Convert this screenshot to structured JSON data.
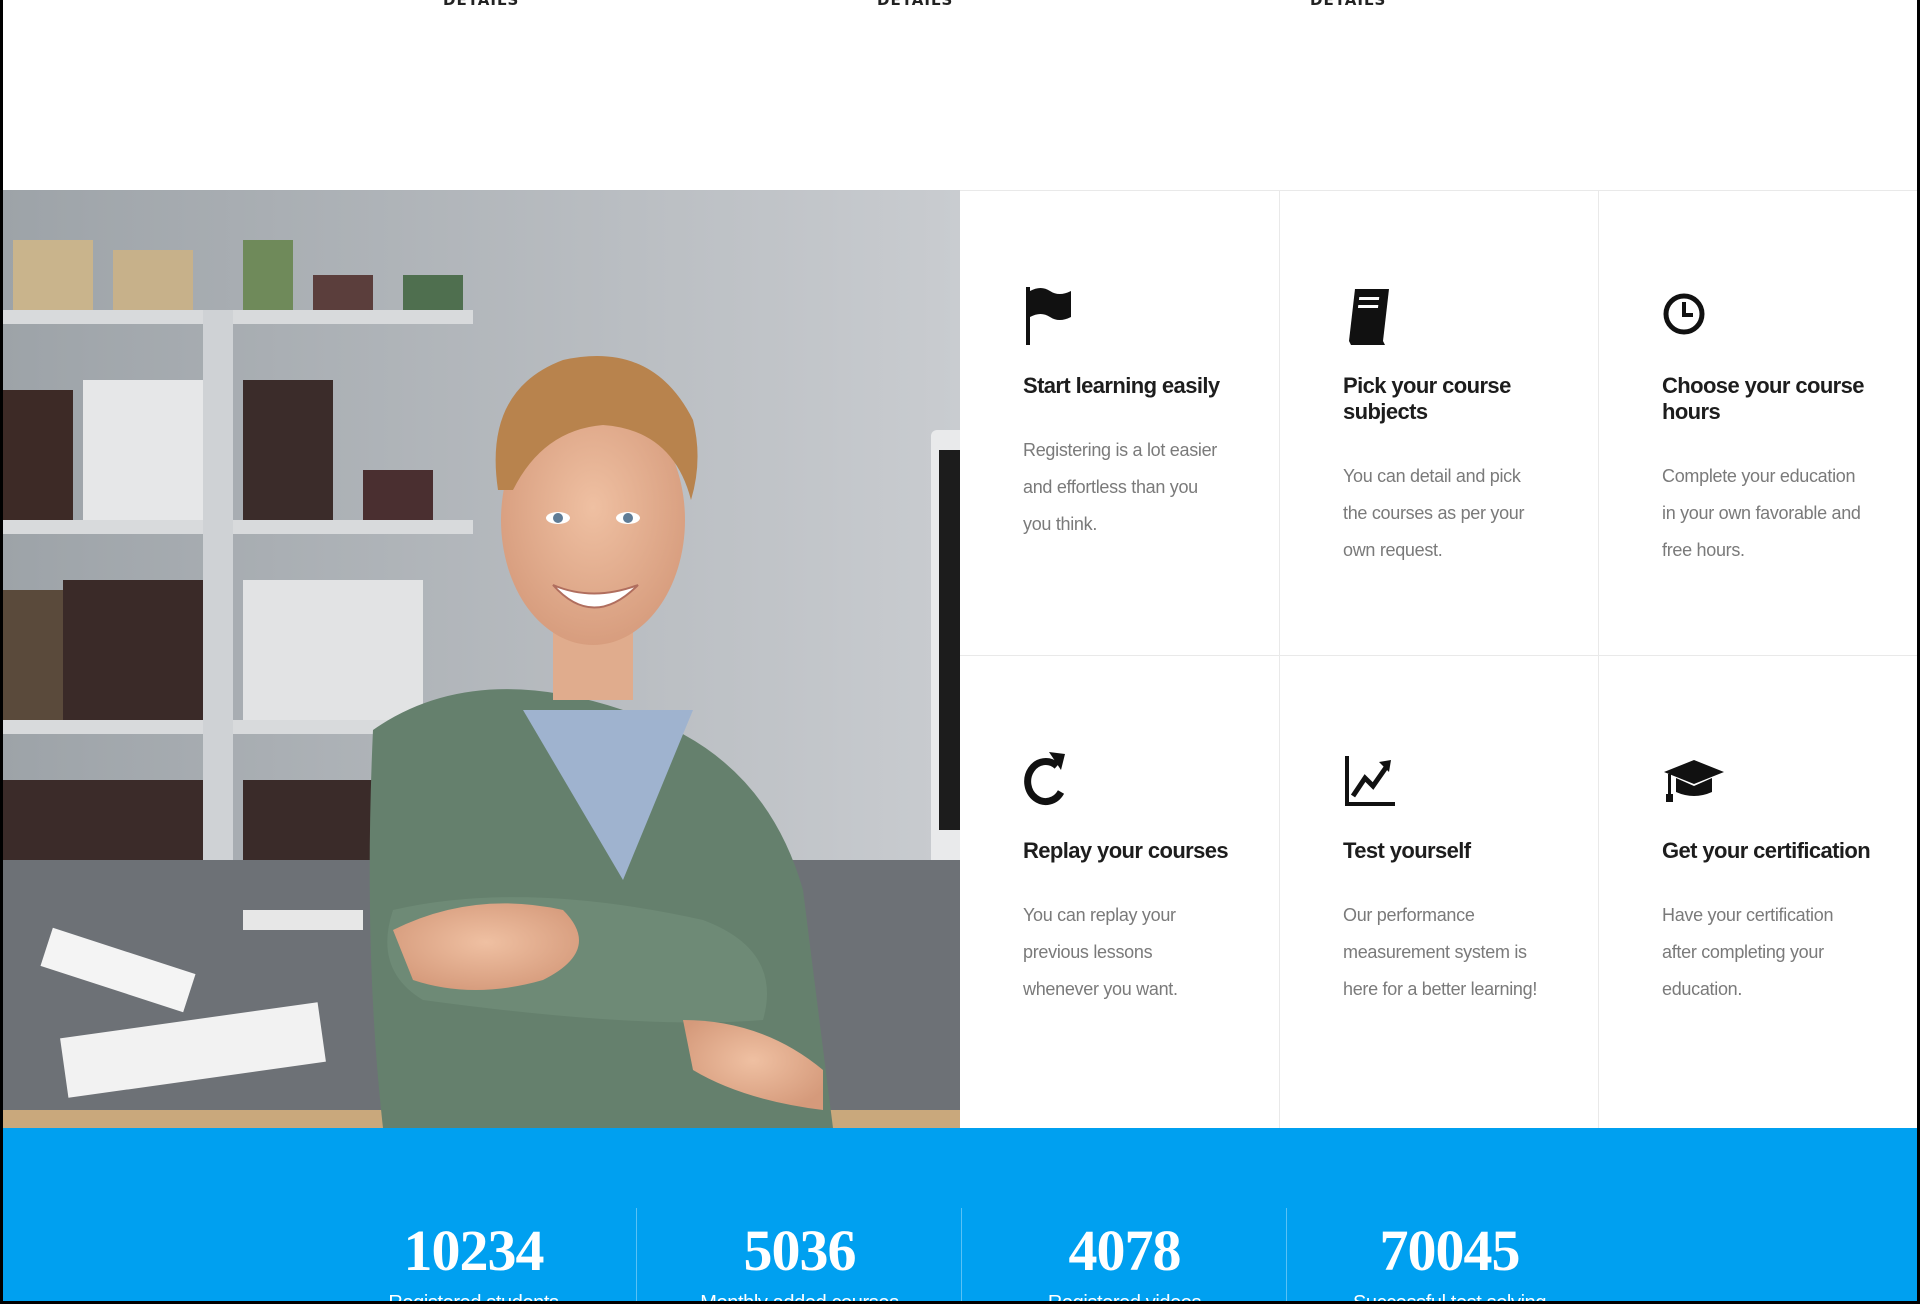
{
  "top_links": [
    "DETAILS",
    "DETAILS",
    "DETAILS"
  ],
  "features": [
    {
      "icon": "flag-icon",
      "title": "Start learning easily",
      "text": "Registering is a lot easier and effortless than you you think."
    },
    {
      "icon": "book-icon",
      "title": "Pick your course subjects",
      "text": "You can detail and pick the courses as per your own request."
    },
    {
      "icon": "clock-icon",
      "title": "Choose your course hours",
      "text": "Complete your education in your own favorable and free hours."
    },
    {
      "icon": "replay-icon",
      "title": "Replay your courses",
      "text": "You can replay your previous lessons whenever you want."
    },
    {
      "icon": "line-chart-icon",
      "title": "Test yourself",
      "text": "Our performance measurement system is here for a better learning!"
    },
    {
      "icon": "graduation-cap-icon",
      "title": "Get your certification",
      "text": "Have your certification after completing your education."
    }
  ],
  "stats": [
    {
      "value": "10234",
      "label": "Registered students"
    },
    {
      "value": "5036",
      "label": "Monthly added courses"
    },
    {
      "value": "4078",
      "label": "Registered videos"
    },
    {
      "value": "70045",
      "label": "Successful test solving"
    }
  ],
  "colors": {
    "accent": "#00a0f0",
    "text_dark": "#1d1d1d",
    "text_muted": "#7a7a7a"
  }
}
